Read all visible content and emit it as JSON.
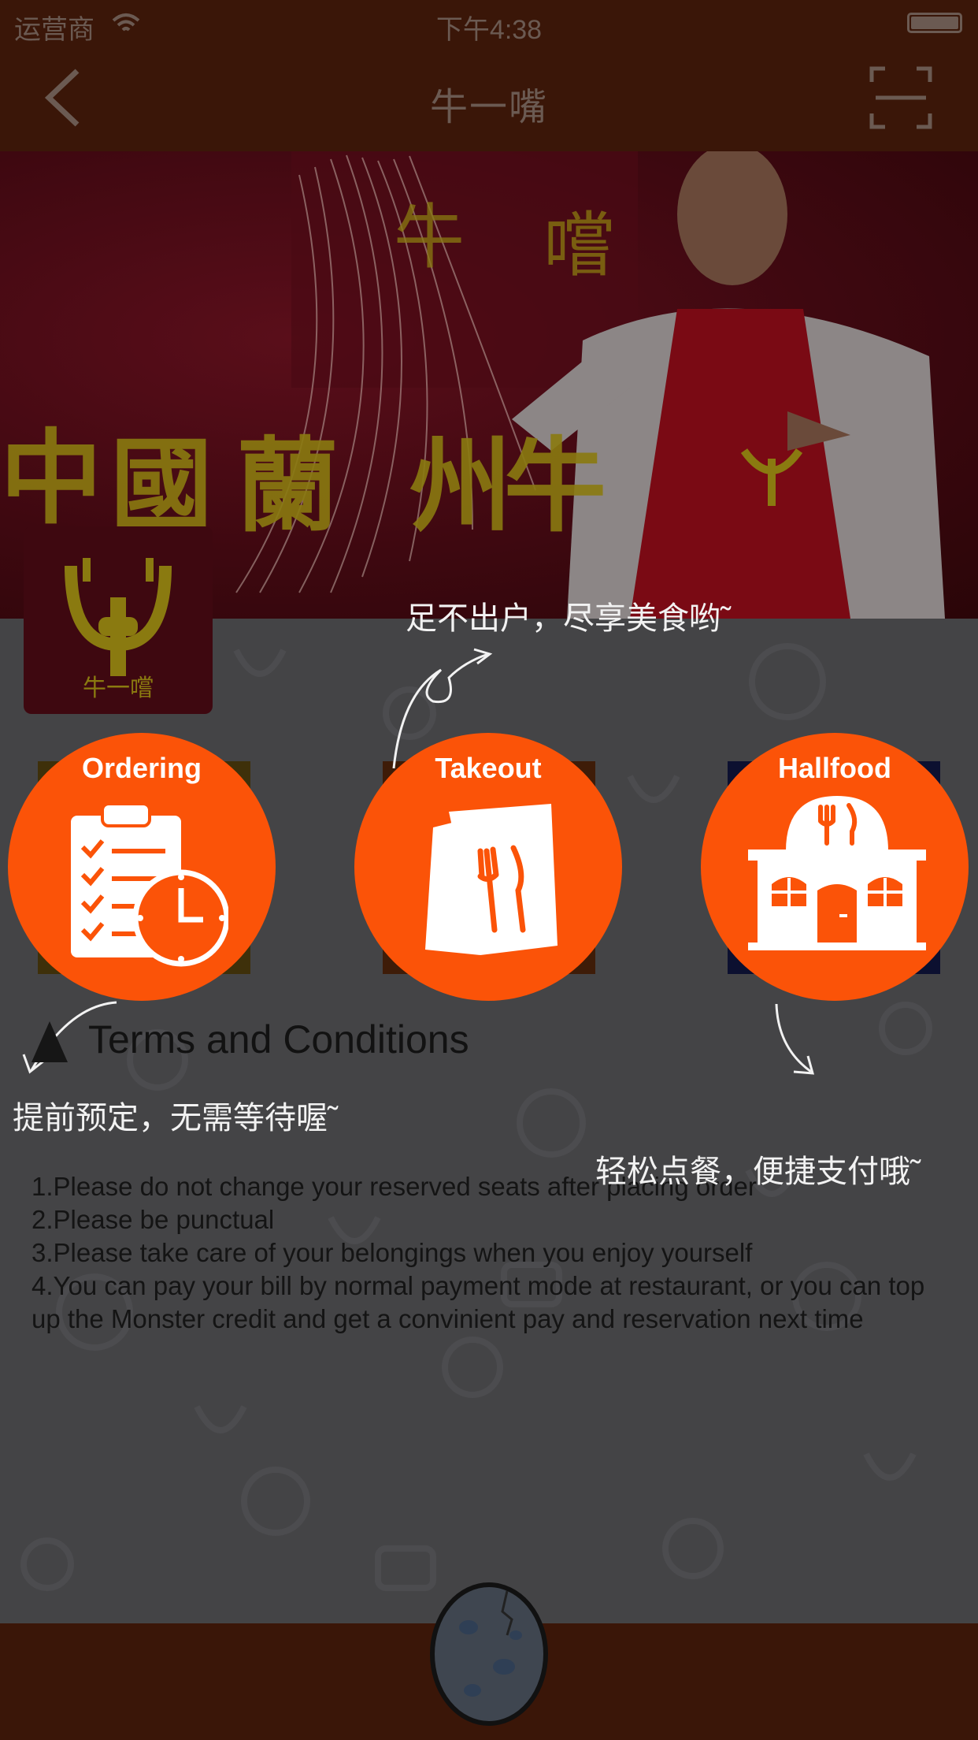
{
  "status_bar": {
    "carrier": "运营商",
    "time": "下午4:38"
  },
  "nav": {
    "title": "牛一嘴"
  },
  "services": [
    {
      "label": "Ordering"
    },
    {
      "label": "Takeout"
    },
    {
      "label": "Hallfood"
    }
  ],
  "hints": {
    "takeout": "足不出户，尽享美食哟˜",
    "ordering": "提前预定，无需等待喔˜",
    "hallfood": "轻松点餐，便捷支付哦˜"
  },
  "terms": {
    "title": "Terms and Conditions",
    "lines": [
      "1.Please do not change your reserved seats after placing order",
      "2.Please be punctual",
      "3.Please take care of your belongings when you enjoy yourself",
      "4.You can pay your bill by normal payment mode at restaurant, or you can top up the Monster credit and get a convinient pay and reservation next time"
    ]
  },
  "colors": {
    "accent": "#fb5308",
    "bar": "#3a1608",
    "overlay_text": "#f2f2f2"
  },
  "icons": [
    "wifi-icon",
    "battery-icon",
    "back-icon",
    "scan-icon",
    "clipboard-clock-icon",
    "takeout-bag-icon",
    "restaurant-icon",
    "warning-icon",
    "egg-icon"
  ]
}
